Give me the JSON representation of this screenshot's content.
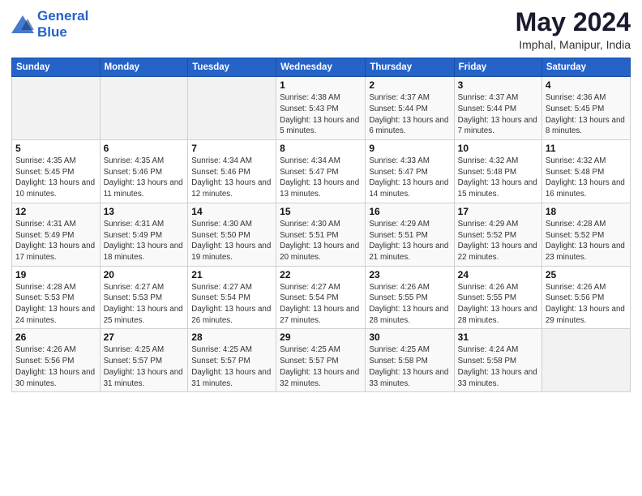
{
  "logo": {
    "line1": "General",
    "line2": "Blue"
  },
  "title": "May 2024",
  "subtitle": "Imphal, Manipur, India",
  "headers": [
    "Sunday",
    "Monday",
    "Tuesday",
    "Wednesday",
    "Thursday",
    "Friday",
    "Saturday"
  ],
  "weeks": [
    [
      {
        "day": "",
        "info": ""
      },
      {
        "day": "",
        "info": ""
      },
      {
        "day": "",
        "info": ""
      },
      {
        "day": "1",
        "info": "Sunrise: 4:38 AM\nSunset: 5:43 PM\nDaylight: 13 hours and 5 minutes."
      },
      {
        "day": "2",
        "info": "Sunrise: 4:37 AM\nSunset: 5:44 PM\nDaylight: 13 hours and 6 minutes."
      },
      {
        "day": "3",
        "info": "Sunrise: 4:37 AM\nSunset: 5:44 PM\nDaylight: 13 hours and 7 minutes."
      },
      {
        "day": "4",
        "info": "Sunrise: 4:36 AM\nSunset: 5:45 PM\nDaylight: 13 hours and 8 minutes."
      }
    ],
    [
      {
        "day": "5",
        "info": "Sunrise: 4:35 AM\nSunset: 5:45 PM\nDaylight: 13 hours and 10 minutes."
      },
      {
        "day": "6",
        "info": "Sunrise: 4:35 AM\nSunset: 5:46 PM\nDaylight: 13 hours and 11 minutes."
      },
      {
        "day": "7",
        "info": "Sunrise: 4:34 AM\nSunset: 5:46 PM\nDaylight: 13 hours and 12 minutes."
      },
      {
        "day": "8",
        "info": "Sunrise: 4:34 AM\nSunset: 5:47 PM\nDaylight: 13 hours and 13 minutes."
      },
      {
        "day": "9",
        "info": "Sunrise: 4:33 AM\nSunset: 5:47 PM\nDaylight: 13 hours and 14 minutes."
      },
      {
        "day": "10",
        "info": "Sunrise: 4:32 AM\nSunset: 5:48 PM\nDaylight: 13 hours and 15 minutes."
      },
      {
        "day": "11",
        "info": "Sunrise: 4:32 AM\nSunset: 5:48 PM\nDaylight: 13 hours and 16 minutes."
      }
    ],
    [
      {
        "day": "12",
        "info": "Sunrise: 4:31 AM\nSunset: 5:49 PM\nDaylight: 13 hours and 17 minutes."
      },
      {
        "day": "13",
        "info": "Sunrise: 4:31 AM\nSunset: 5:49 PM\nDaylight: 13 hours and 18 minutes."
      },
      {
        "day": "14",
        "info": "Sunrise: 4:30 AM\nSunset: 5:50 PM\nDaylight: 13 hours and 19 minutes."
      },
      {
        "day": "15",
        "info": "Sunrise: 4:30 AM\nSunset: 5:51 PM\nDaylight: 13 hours and 20 minutes."
      },
      {
        "day": "16",
        "info": "Sunrise: 4:29 AM\nSunset: 5:51 PM\nDaylight: 13 hours and 21 minutes."
      },
      {
        "day": "17",
        "info": "Sunrise: 4:29 AM\nSunset: 5:52 PM\nDaylight: 13 hours and 22 minutes."
      },
      {
        "day": "18",
        "info": "Sunrise: 4:28 AM\nSunset: 5:52 PM\nDaylight: 13 hours and 23 minutes."
      }
    ],
    [
      {
        "day": "19",
        "info": "Sunrise: 4:28 AM\nSunset: 5:53 PM\nDaylight: 13 hours and 24 minutes."
      },
      {
        "day": "20",
        "info": "Sunrise: 4:27 AM\nSunset: 5:53 PM\nDaylight: 13 hours and 25 minutes."
      },
      {
        "day": "21",
        "info": "Sunrise: 4:27 AM\nSunset: 5:54 PM\nDaylight: 13 hours and 26 minutes."
      },
      {
        "day": "22",
        "info": "Sunrise: 4:27 AM\nSunset: 5:54 PM\nDaylight: 13 hours and 27 minutes."
      },
      {
        "day": "23",
        "info": "Sunrise: 4:26 AM\nSunset: 5:55 PM\nDaylight: 13 hours and 28 minutes."
      },
      {
        "day": "24",
        "info": "Sunrise: 4:26 AM\nSunset: 5:55 PM\nDaylight: 13 hours and 28 minutes."
      },
      {
        "day": "25",
        "info": "Sunrise: 4:26 AM\nSunset: 5:56 PM\nDaylight: 13 hours and 29 minutes."
      }
    ],
    [
      {
        "day": "26",
        "info": "Sunrise: 4:26 AM\nSunset: 5:56 PM\nDaylight: 13 hours and 30 minutes."
      },
      {
        "day": "27",
        "info": "Sunrise: 4:25 AM\nSunset: 5:57 PM\nDaylight: 13 hours and 31 minutes."
      },
      {
        "day": "28",
        "info": "Sunrise: 4:25 AM\nSunset: 5:57 PM\nDaylight: 13 hours and 31 minutes."
      },
      {
        "day": "29",
        "info": "Sunrise: 4:25 AM\nSunset: 5:57 PM\nDaylight: 13 hours and 32 minutes."
      },
      {
        "day": "30",
        "info": "Sunrise: 4:25 AM\nSunset: 5:58 PM\nDaylight: 13 hours and 33 minutes."
      },
      {
        "day": "31",
        "info": "Sunrise: 4:24 AM\nSunset: 5:58 PM\nDaylight: 13 hours and 33 minutes."
      },
      {
        "day": "",
        "info": ""
      }
    ]
  ]
}
